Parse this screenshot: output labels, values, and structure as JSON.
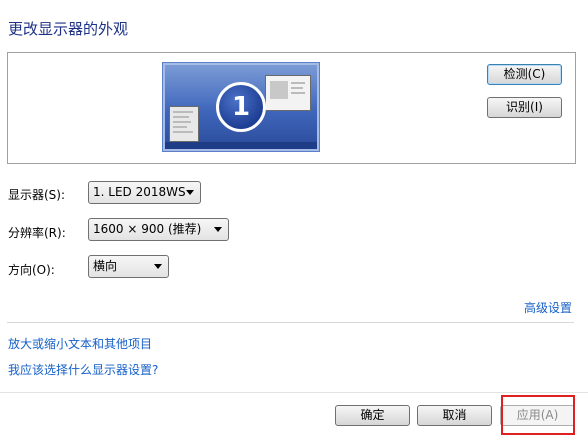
{
  "window": {
    "title": "更改显示器的外观"
  },
  "preview": {
    "monitor_number": "1",
    "detect_label": "检测(C)",
    "identify_label": "识别(I)"
  },
  "settings": {
    "display": {
      "label": "显示器(S):",
      "value": "1. LED 2018WS"
    },
    "resolution": {
      "label": "分辨率(R):",
      "value": "1600 × 900 (推荐)"
    },
    "orientation": {
      "label": "方向(O):",
      "value": "横向"
    }
  },
  "links": {
    "advanced": "高级设置",
    "text_size": "放大或缩小文本和其他项目",
    "which_settings": "我应该选择什么显示器设置?"
  },
  "footer": {
    "ok_label": "确定",
    "cancel_label": "取消",
    "apply_label": "应用(A)"
  },
  "colors": {
    "link": "#1660c8",
    "title": "#1e3287",
    "highlight": "#e02020"
  }
}
